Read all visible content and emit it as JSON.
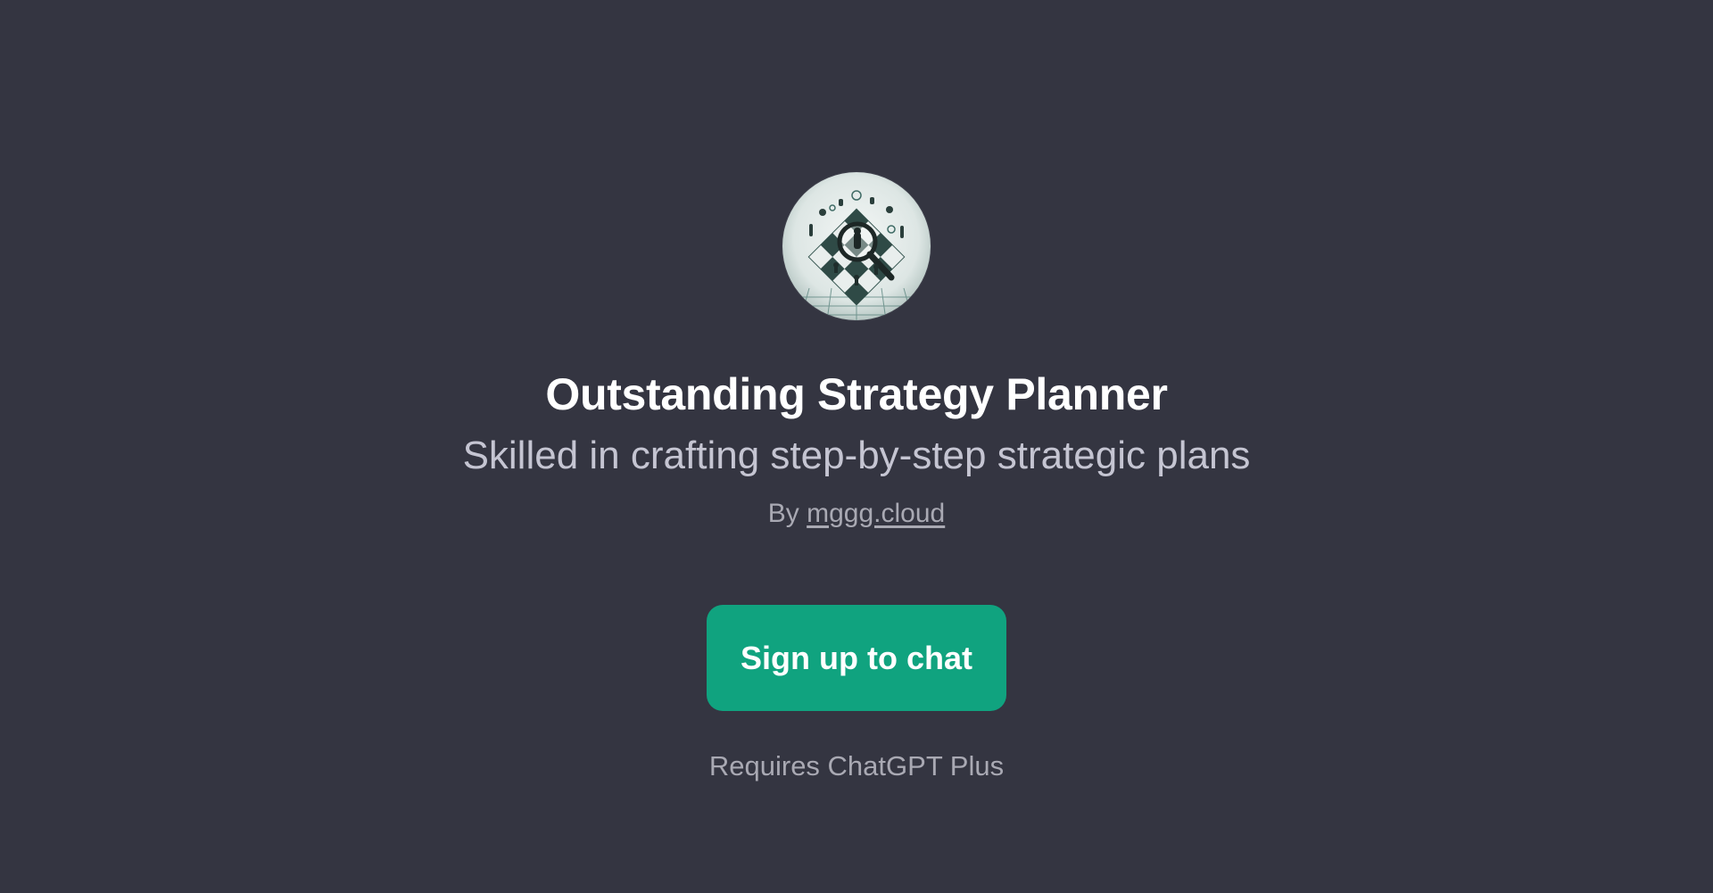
{
  "gpt": {
    "title": "Outstanding Strategy Planner",
    "description": "Skilled in crafting step-by-step strategic plans",
    "by_prefix": "By ",
    "author": "mggg.cloud",
    "avatar_icon": "chessboard-magnifier-icon"
  },
  "actions": {
    "signup_label": "Sign up to chat"
  },
  "footer": {
    "requirement": "Requires ChatGPT Plus"
  },
  "colors": {
    "background": "#343541",
    "accent": "#10a37f",
    "muted_text": "#a9a9b3",
    "subtitle_text": "#c5c5d2"
  }
}
